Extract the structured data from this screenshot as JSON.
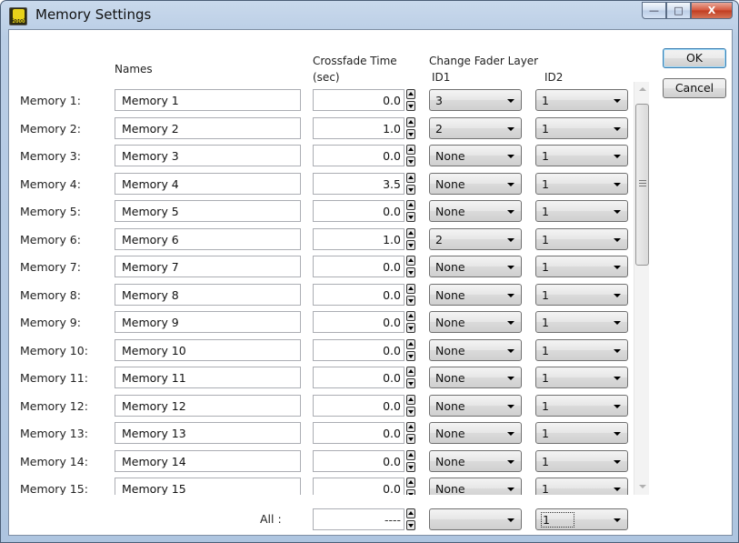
{
  "window": {
    "title": "Memory Settings",
    "app_icon": "dl-2000-logo-icon",
    "app_icon_text": "2000",
    "controls": {
      "minimize": "—",
      "maximize": "□",
      "close": "X"
    }
  },
  "headers": {
    "names": "Names",
    "crossfade_line1": "Crossfade Time",
    "crossfade_line2": "(sec)",
    "change_fader": "Change Fader Layer",
    "id1": "ID1",
    "id2": "ID2"
  },
  "buttons": {
    "ok": "OK",
    "cancel": "Cancel"
  },
  "rows": [
    {
      "label": "Memory 1:",
      "name": "Memory 1",
      "time": "0.0",
      "id1": "3",
      "id2": "1"
    },
    {
      "label": "Memory 2:",
      "name": "Memory 2",
      "time": "1.0",
      "id1": "2",
      "id2": "1"
    },
    {
      "label": "Memory 3:",
      "name": "Memory 3",
      "time": "0.0",
      "id1": "None",
      "id2": "1"
    },
    {
      "label": "Memory 4:",
      "name": "Memory 4",
      "time": "3.5",
      "id1": "None",
      "id2": "1"
    },
    {
      "label": "Memory 5:",
      "name": "Memory 5",
      "time": "0.0",
      "id1": "None",
      "id2": "1"
    },
    {
      "label": "Memory 6:",
      "name": "Memory 6",
      "time": "1.0",
      "id1": "2",
      "id2": "1"
    },
    {
      "label": "Memory 7:",
      "name": "Memory 7",
      "time": "0.0",
      "id1": "None",
      "id2": "1"
    },
    {
      "label": "Memory 8:",
      "name": "Memory 8",
      "time": "0.0",
      "id1": "None",
      "id2": "1"
    },
    {
      "label": "Memory 9:",
      "name": "Memory 9",
      "time": "0.0",
      "id1": "None",
      "id2": "1"
    },
    {
      "label": "Memory 10:",
      "name": "Memory 10",
      "time": "0.0",
      "id1": "None",
      "id2": "1"
    },
    {
      "label": "Memory 11:",
      "name": "Memory 11",
      "time": "0.0",
      "id1": "None",
      "id2": "1"
    },
    {
      "label": "Memory 12:",
      "name": "Memory 12",
      "time": "0.0",
      "id1": "None",
      "id2": "1"
    },
    {
      "label": "Memory 13:",
      "name": "Memory 13",
      "time": "0.0",
      "id1": "None",
      "id2": "1"
    },
    {
      "label": "Memory 14:",
      "name": "Memory 14",
      "time": "0.0",
      "id1": "None",
      "id2": "1"
    },
    {
      "label": "Memory 15:",
      "name": "Memory 15",
      "time": "0.0",
      "id1": "None",
      "id2": "1"
    }
  ],
  "all_row": {
    "label": "All :",
    "time": "----",
    "id1": "",
    "id2": "1"
  }
}
